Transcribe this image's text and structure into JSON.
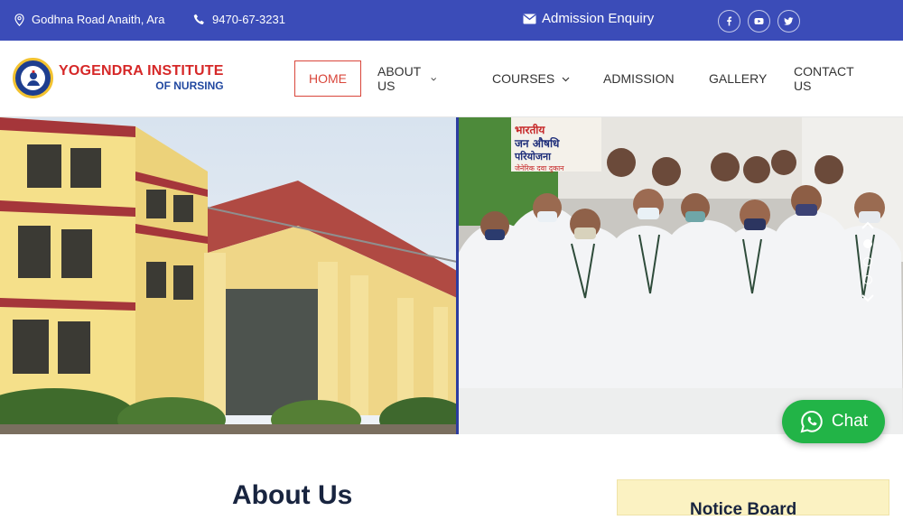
{
  "topbar": {
    "address": "Godhna Road Anaith, Ara",
    "phone": "9470-67-3231",
    "enquiry": "Admission Enquiry",
    "socials": [
      "facebook-icon",
      "youtube-icon",
      "twitter-icon"
    ]
  },
  "brand": {
    "line1": "YOGENDRA INSTITUTE",
    "line2": "OF NURSING"
  },
  "nav": {
    "home": "HOME",
    "about": "ABOUT US",
    "courses": "COURSES",
    "admission": "ADMISSION",
    "gallery": "GALLERY",
    "contact": "CONTACT US"
  },
  "hero": {
    "sign_line1": "भारतीय",
    "sign_line2": "जन औषधि",
    "sign_line3": "परियोजना",
    "sign_line4": "जेनेरिक दवा दुकान"
  },
  "chat": {
    "label": "Chat"
  },
  "sections": {
    "about_title": "About Us",
    "notice_title": "Notice Board"
  },
  "colors": {
    "topbar": "#3b4cb8",
    "accent": "#d9463b",
    "chat": "#22b447"
  }
}
